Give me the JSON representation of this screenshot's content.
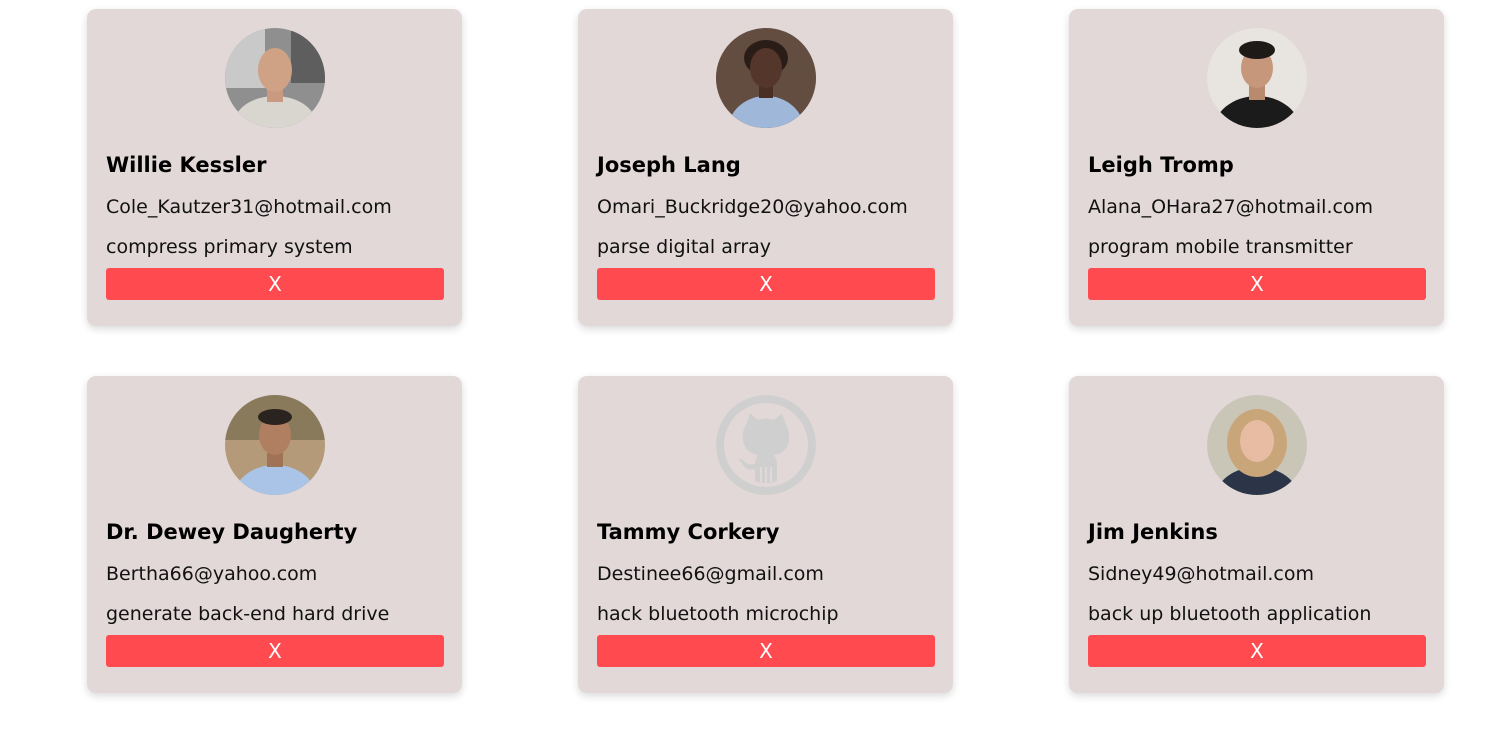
{
  "delete_label": "X",
  "colors": {
    "card_bg": "#e2d8d8",
    "delete_button": "#ff4a4f"
  },
  "cards": [
    {
      "name": "",
      "email": "",
      "description": "",
      "avatar": "photo"
    },
    {
      "name": "",
      "email": "",
      "description": "",
      "avatar": "photo"
    },
    {
      "name": "",
      "email": "",
      "description": "",
      "avatar": "photo"
    },
    {
      "name": "Willie Kessler",
      "email": "Cole_Kautzer31@hotmail.com",
      "description": "compress primary system",
      "avatar": "photo-man-bald"
    },
    {
      "name": "Joseph Lang",
      "email": "Omari_Buckridge20@yahoo.com",
      "description": "parse digital array",
      "avatar": "photo-woman"
    },
    {
      "name": "Leigh Tromp",
      "email": "Alana_OHara27@hotmail.com",
      "description": "program mobile transmitter",
      "avatar": "photo-man-dark-hair"
    },
    {
      "name": "Dr. Dewey Daugherty",
      "email": "Bertha66@yahoo.com",
      "description": "generate back-end hard drive",
      "avatar": "photo-man-blue-shirt"
    },
    {
      "name": "Tammy Corkery",
      "email": "Destinee66@gmail.com",
      "description": "hack bluetooth microchip",
      "avatar": "github-icon"
    },
    {
      "name": "Jim Jenkins",
      "email": "Sidney49@hotmail.com",
      "description": "back up bluetooth application",
      "avatar": "photo-woman-blonde"
    }
  ]
}
